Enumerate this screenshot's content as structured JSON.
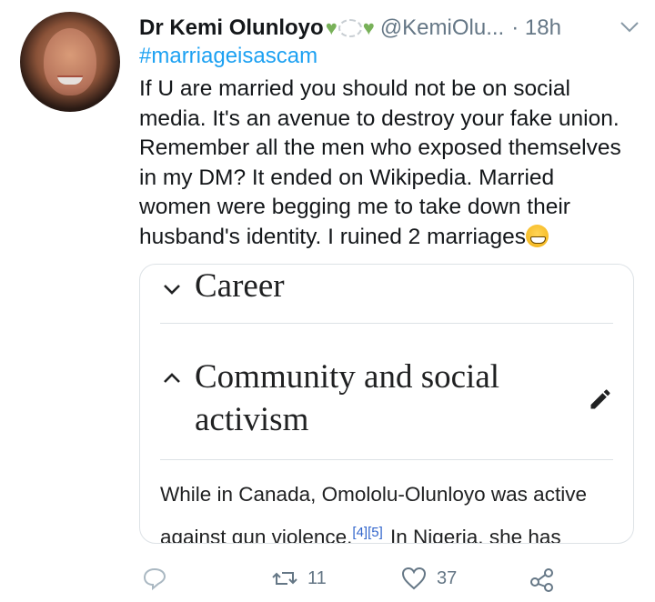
{
  "tweet": {
    "author_name": "Dr Kemi Olunloyo",
    "handle": "@KemiOlu...",
    "time": "· 18h",
    "hashtag": "#marriageisascam",
    "lines": [
      "If U are married you should not be on social",
      "media. It's an avenue to destroy your fake union.",
      "Remember all the men who exposed themselves",
      "in my DM? It ended on Wikipedia. Married",
      "women were begging me to take down their",
      "husband's identity. I ruined 2 marriages"
    ],
    "emoji_end": "grinning-face",
    "author_emojis": [
      "green-heart",
      "thought-bubble",
      "green-heart"
    ]
  },
  "card": {
    "section1": "Career",
    "section2_line1": "Community and social",
    "section2_line2": "activism",
    "para_line1": "While in Canada, Omololu-Olunloyo was active",
    "para_line2_a": "against gun violence.",
    "para_refs": "[4][5]",
    "para_line2_b": " In Nigeria, she has"
  },
  "actions": {
    "reply_count": "",
    "retweet_count": "11",
    "like_count": "37"
  },
  "colors": {
    "link": "#1da1f2",
    "muted": "#657786",
    "wiki_ref": "#3366cc"
  }
}
